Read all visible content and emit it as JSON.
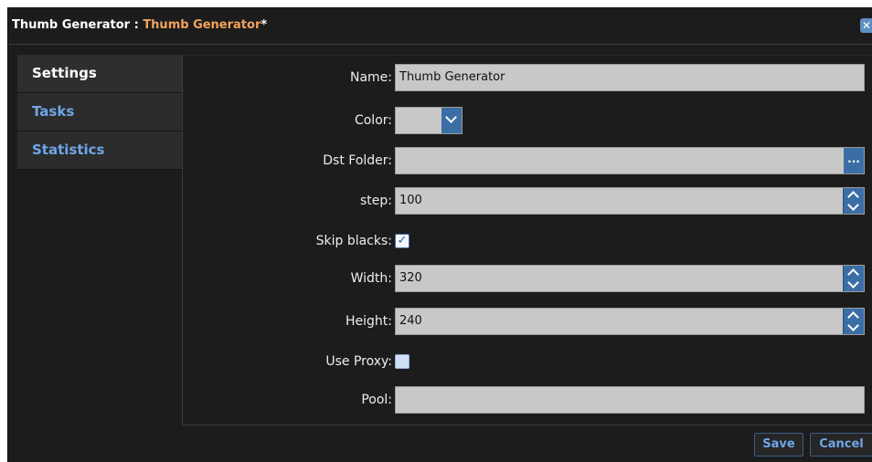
{
  "window": {
    "title_prefix": "Thumb Generator : ",
    "title_name": "Thumb Generator",
    "title_suffix": "*",
    "close_glyph": "✕"
  },
  "sidebar": {
    "items": [
      {
        "label": "Settings",
        "active": true
      },
      {
        "label": "Tasks",
        "active": false
      },
      {
        "label": "Statistics",
        "active": false
      }
    ]
  },
  "form": {
    "name": {
      "label": "Name:",
      "value": "Thumb Generator"
    },
    "color": {
      "label": "Color:",
      "value": ""
    },
    "dst_folder": {
      "label": "Dst Folder:",
      "value": "",
      "browse_glyph": "..."
    },
    "step": {
      "label": "step:",
      "value": "100"
    },
    "skip_blacks": {
      "label": "Skip blacks:",
      "checked": true,
      "glyph": "✓"
    },
    "width": {
      "label": "Width:",
      "value": "320"
    },
    "height": {
      "label": "Height:",
      "value": "240"
    },
    "use_proxy": {
      "label": "Use Proxy:",
      "checked": false
    },
    "pool": {
      "label": "Pool:",
      "value": ""
    }
  },
  "footer": {
    "save_label": "Save",
    "cancel_label": "Cancel"
  },
  "colors": {
    "accent": "#f2a45a",
    "link": "#6fa6e8",
    "button_blue": "#3b6ea5",
    "background": "#1c1c1c"
  }
}
